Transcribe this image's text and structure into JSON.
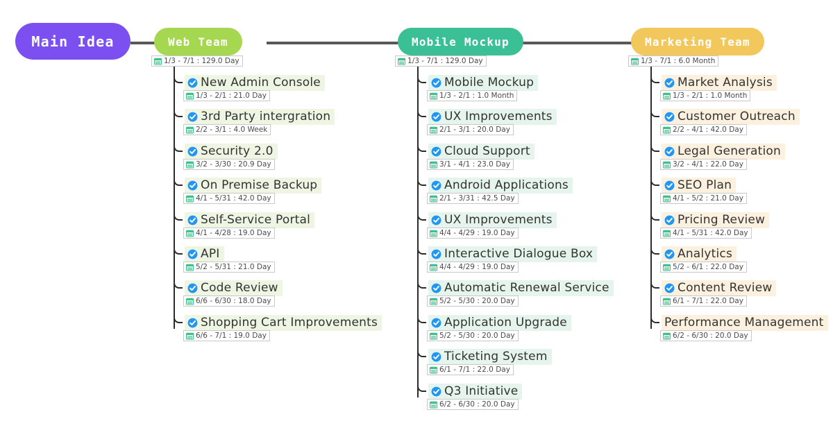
{
  "root": {
    "label": "Main Idea",
    "color": "#7b4ff0"
  },
  "branches": [
    {
      "id": "web",
      "label": "Web Team",
      "color": "#a6d751",
      "highlight": "#eef6e3",
      "duration": "1/3 - 7/1 : 129.0 Day",
      "tasks": [
        {
          "label": "New Admin Console",
          "duration": "1/3 - 2/1 : 21.0 Day",
          "checked": true
        },
        {
          "label": "3rd Party intergration",
          "duration": "2/2 - 3/1 : 4.0 Week",
          "checked": true
        },
        {
          "label": "Security 2.0",
          "duration": "3/2 - 3/30 : 20.9 Day",
          "checked": true
        },
        {
          "label": "On Premise Backup",
          "duration": "4/1 - 5/31 : 42.0 Day",
          "checked": true
        },
        {
          "label": "Self-Service Portal",
          "duration": "4/1 - 4/28 : 19.0 Day",
          "checked": true
        },
        {
          "label": "API",
          "duration": "5/2 - 5/31 : 21.0 Day",
          "checked": true
        },
        {
          "label": "Code Review",
          "duration": "6/6 - 6/30 : 18.0 Day",
          "checked": true
        },
        {
          "label": "Shopping Cart Improvements",
          "duration": "6/6 - 7/1 : 19.0 Day",
          "checked": true
        }
      ]
    },
    {
      "id": "mobile",
      "label": "Mobile Mockup",
      "color": "#3bbf95",
      "highlight": "#e6f4ee",
      "duration": "1/3 - 7/1 : 129.0 Day",
      "tasks": [
        {
          "label": "Mobile Mockup",
          "duration": "1/3 - 2/1 : 1.0 Month",
          "checked": true
        },
        {
          "label": "UX Improvements",
          "duration": "2/1 - 3/1 : 20.0 Day",
          "checked": true
        },
        {
          "label": "Cloud Support",
          "duration": "3/1 - 4/1 : 23.0 Day",
          "checked": true
        },
        {
          "label": "Android Applications",
          "duration": "2/1 - 3/31 : 42.5 Day",
          "checked": true
        },
        {
          "label": "UX Improvements",
          "duration": "4/4 - 4/29 : 19.0 Day",
          "checked": true
        },
        {
          "label": "Interactive Dialogue Box",
          "duration": "4/4 - 4/29 : 19.0 Day",
          "checked": true
        },
        {
          "label": "Automatic Renewal Service",
          "duration": "5/2 - 5/30 : 20.0 Day",
          "checked": true
        },
        {
          "label": "Application Upgrade",
          "duration": "5/2 - 5/30 : 20.0 Day",
          "checked": true
        },
        {
          "label": "Ticketing System",
          "duration": "6/1 - 7/1 : 22.0 Day",
          "checked": true
        },
        {
          "label": "Q3 Initiative",
          "duration": "6/2 - 6/30 : 20.0 Day",
          "checked": true
        }
      ]
    },
    {
      "id": "market",
      "label": "Marketing Team",
      "color": "#f2c75c",
      "highlight": "#fcf0de",
      "duration": "1/3 - 7/1 : 6.0 Month",
      "tasks": [
        {
          "label": "Market Analysis",
          "duration": "1/3 - 2/1 : 1.0 Month",
          "checked": true
        },
        {
          "label": "Customer Outreach",
          "duration": "2/2 - 4/1 : 42.0 Day",
          "checked": true
        },
        {
          "label": "Legal Generation",
          "duration": "3/2 - 4/1 : 22.0 Day",
          "checked": true
        },
        {
          "label": "SEO Plan",
          "duration": "4/1 - 5/2 : 21.0 Day",
          "checked": true
        },
        {
          "label": "Pricing Review",
          "duration": "4/1 - 5/31 : 42.0 Day",
          "checked": true
        },
        {
          "label": "Analytics",
          "duration": "5/2 - 6/1 : 22.0 Day",
          "checked": true
        },
        {
          "label": "Content Review",
          "duration": "6/1 - 7/1 : 22.0 Day",
          "checked": true
        },
        {
          "label": "Performance Management",
          "duration": "6/2 - 6/30 : 20.0 Day",
          "checked": false
        }
      ]
    }
  ],
  "icons": {
    "check": "check-circle-icon",
    "calendar": "calendar-icon"
  },
  "colors": {
    "spine": "#585858",
    "connector": "#2c2c2c",
    "text": "#333333",
    "badge_text": "#4a4a4a",
    "badge_border": "#c9c9c9",
    "check_blue": "#2196f3",
    "calendar_green": "#3fc08d"
  }
}
